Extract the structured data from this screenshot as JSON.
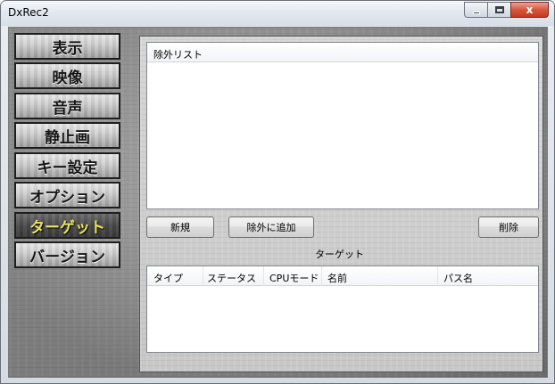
{
  "window": {
    "title": "DxRec2",
    "close_glyph": "x"
  },
  "nav": {
    "items": [
      {
        "label": "表示"
      },
      {
        "label": "映像"
      },
      {
        "label": "音声"
      },
      {
        "label": "静止画"
      },
      {
        "label": "キー設定"
      },
      {
        "label": "オプション"
      },
      {
        "label": "ターゲット"
      },
      {
        "label": "バージョン"
      }
    ],
    "active": "ターゲット"
  },
  "exclusion_list": {
    "header": "除外リスト"
  },
  "buttons": {
    "new_label": "新規",
    "add_exclusion_label": "除外に追加",
    "delete_label": "削除"
  },
  "target_section": {
    "title": "ターゲット",
    "columns": [
      "タイプ",
      "ステータス",
      "CPUモード",
      "名前",
      "パス名"
    ]
  }
}
